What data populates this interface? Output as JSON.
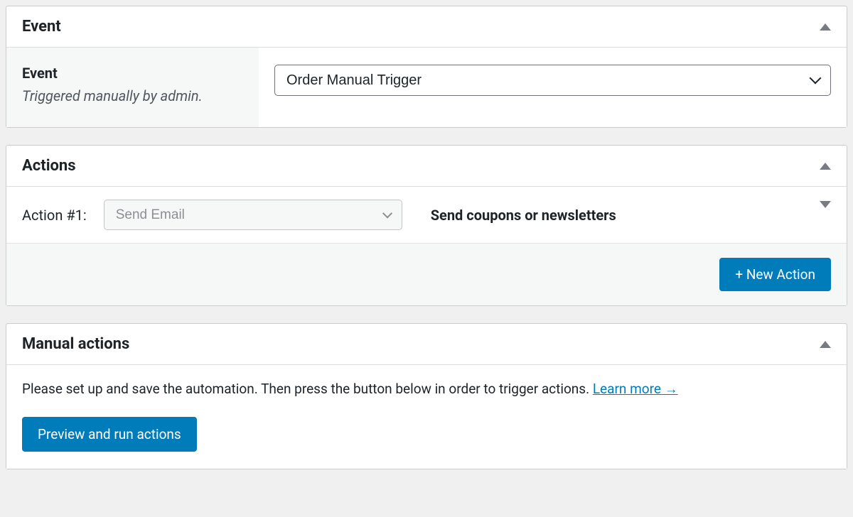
{
  "event_panel": {
    "title": "Event",
    "label": "Event",
    "description": "Triggered manually by admin.",
    "select_value": "Order Manual Trigger"
  },
  "actions_panel": {
    "title": "Actions",
    "action_number": "Action #1:",
    "action_select": "Send Email",
    "action_title": "Send coupons or newsletters",
    "new_action_button": "+ New Action"
  },
  "manual_panel": {
    "title": "Manual actions",
    "description": "Please set up and save the automation. Then press the button below in order to trigger actions. ",
    "learn_more": "Learn more →",
    "run_button": "Preview and run actions"
  }
}
